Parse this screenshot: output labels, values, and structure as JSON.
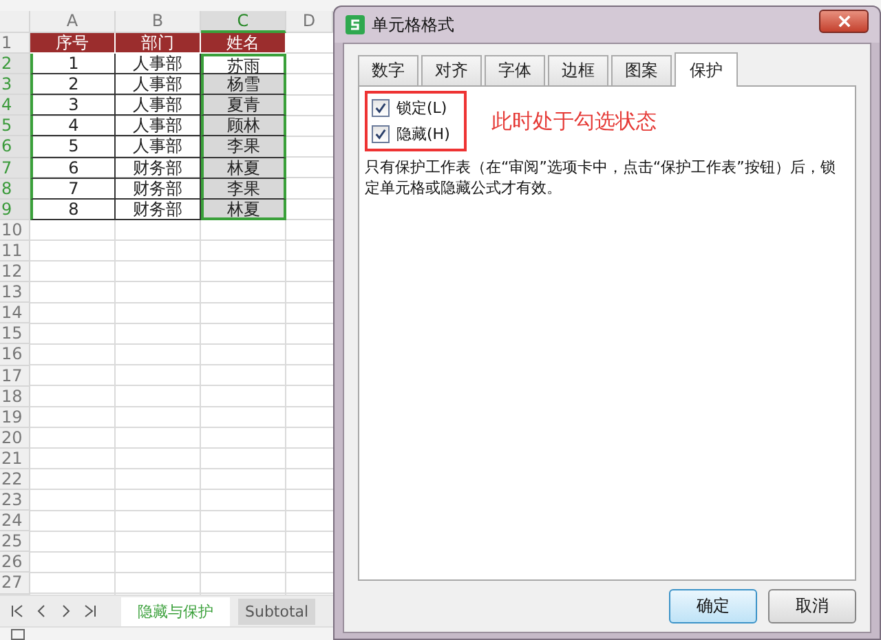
{
  "spreadsheet": {
    "columns": [
      {
        "label": "A",
        "selected": false
      },
      {
        "label": "B",
        "selected": false
      },
      {
        "label": "C",
        "selected": true
      },
      {
        "label": "D",
        "selected": false
      }
    ],
    "rows": [
      {
        "number": "1",
        "kind": "header",
        "selected": false,
        "cells": [
          "序号",
          "部门",
          "姓名"
        ]
      },
      {
        "number": "2",
        "kind": "data",
        "selected": true,
        "highlighted": false,
        "cells": [
          "1",
          "人事部",
          "苏雨"
        ]
      },
      {
        "number": "3",
        "kind": "data",
        "selected": true,
        "highlighted": true,
        "cells": [
          "2",
          "人事部",
          "杨雪"
        ]
      },
      {
        "number": "4",
        "kind": "data",
        "selected": true,
        "highlighted": true,
        "cells": [
          "3",
          "人事部",
          "夏青"
        ]
      },
      {
        "number": "5",
        "kind": "data",
        "selected": true,
        "highlighted": true,
        "cells": [
          "4",
          "人事部",
          "顾林"
        ]
      },
      {
        "number": "6",
        "kind": "data",
        "selected": true,
        "highlighted": true,
        "cells": [
          "5",
          "人事部",
          "李果"
        ]
      },
      {
        "number": "7",
        "kind": "data",
        "selected": true,
        "highlighted": true,
        "cells": [
          "6",
          "财务部",
          "林夏"
        ]
      },
      {
        "number": "8",
        "kind": "data",
        "selected": true,
        "highlighted": true,
        "cells": [
          "7",
          "财务部",
          "李果"
        ]
      },
      {
        "number": "9",
        "kind": "data",
        "selected": true,
        "highlighted": true,
        "cells": [
          "8",
          "财务部",
          "林夏"
        ]
      },
      {
        "number": "10",
        "kind": "empty",
        "selected": false
      },
      {
        "number": "11",
        "kind": "empty",
        "selected": false
      },
      {
        "number": "12",
        "kind": "empty",
        "selected": false
      },
      {
        "number": "13",
        "kind": "empty",
        "selected": false
      },
      {
        "number": "14",
        "kind": "empty",
        "selected": false
      },
      {
        "number": "15",
        "kind": "empty",
        "selected": false
      },
      {
        "number": "16",
        "kind": "empty",
        "selected": false
      },
      {
        "number": "17",
        "kind": "empty",
        "selected": false
      },
      {
        "number": "18",
        "kind": "empty",
        "selected": false
      },
      {
        "number": "19",
        "kind": "empty",
        "selected": false
      },
      {
        "number": "20",
        "kind": "empty",
        "selected": false
      },
      {
        "number": "21",
        "kind": "empty",
        "selected": false
      },
      {
        "number": "22",
        "kind": "empty",
        "selected": false
      },
      {
        "number": "23",
        "kind": "empty",
        "selected": false
      },
      {
        "number": "24",
        "kind": "empty",
        "selected": false
      },
      {
        "number": "25",
        "kind": "empty",
        "selected": false
      },
      {
        "number": "26",
        "kind": "empty",
        "selected": false
      },
      {
        "number": "27",
        "kind": "empty",
        "selected": false
      }
    ],
    "sheet_tabs": [
      {
        "label": "隐藏与保护",
        "selected": true
      },
      {
        "label": "Subtotal",
        "selected": false
      }
    ]
  },
  "dialog": {
    "title": "单元格格式",
    "tabs": [
      {
        "label": "数字",
        "selected": false
      },
      {
        "label": "对齐",
        "selected": false
      },
      {
        "label": "字体",
        "selected": false
      },
      {
        "label": "边框",
        "selected": false
      },
      {
        "label": "图案",
        "selected": false
      },
      {
        "label": "保护",
        "selected": true
      }
    ],
    "checkboxes": [
      {
        "label": "锁定(L)",
        "checked": true
      },
      {
        "label": "隐藏(H)",
        "checked": true
      }
    ],
    "annotation": "此时处于勾选状态",
    "note": "只有保护工作表（在“审阅”选项卡中，点击“保护工作表”按钮）后，锁定单元格或隐藏公式才有效。",
    "buttons": [
      {
        "label": "确定",
        "kind": "primary"
      },
      {
        "label": "取消",
        "kind": "normal"
      }
    ]
  }
}
